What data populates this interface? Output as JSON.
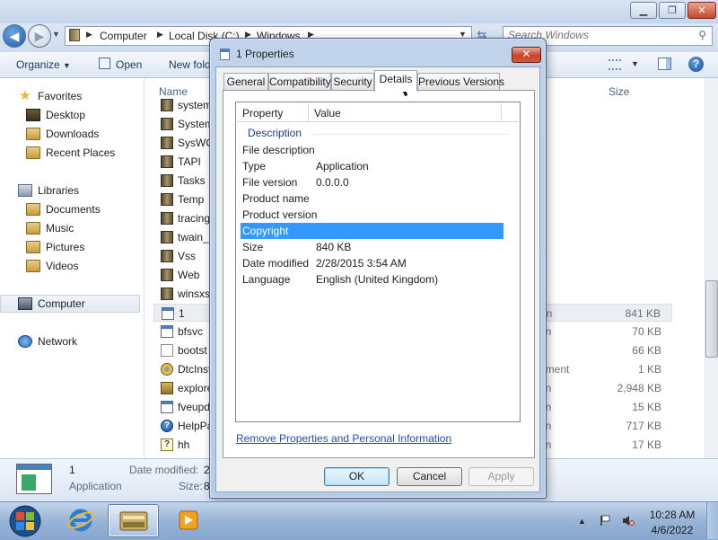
{
  "explorer": {
    "breadcrumb": [
      "Computer",
      "Local Disk (C:)",
      "Windows"
    ],
    "search_placeholder": "Search Windows",
    "toolbar": {
      "organize": "Organize",
      "open": "Open",
      "new_folder": "New fold"
    },
    "nav": {
      "favorites": "Favorites",
      "favorites_items": [
        "Desktop",
        "Downloads",
        "Recent Places"
      ],
      "libraries": "Libraries",
      "libraries_items": [
        "Documents",
        "Music",
        "Pictures",
        "Videos"
      ],
      "computer": "Computer",
      "network": "Network"
    },
    "columns": {
      "name": "Name",
      "size": "Size"
    },
    "files": [
      {
        "name": "system",
        "type": "",
        "size": "",
        "icon": "folder-icon"
      },
      {
        "name": "System",
        "type": "",
        "size": "",
        "icon": "folder-icon"
      },
      {
        "name": "SysWC",
        "type": "",
        "size": "",
        "icon": "folder-icon"
      },
      {
        "name": "TAPI",
        "type": "",
        "size": "",
        "icon": "folder-icon"
      },
      {
        "name": "Tasks",
        "type": "",
        "size": "",
        "icon": "folder-icon"
      },
      {
        "name": "Temp",
        "type": "",
        "size": "",
        "icon": "folder-icon"
      },
      {
        "name": "tracing",
        "type": "",
        "size": "",
        "icon": "folder-icon"
      },
      {
        "name": "twain_",
        "type": "",
        "size": "",
        "icon": "folder-icon"
      },
      {
        "name": "Vss",
        "type": "",
        "size": "",
        "icon": "folder-icon"
      },
      {
        "name": "Web",
        "type": "",
        "size": "",
        "icon": "folder-icon"
      },
      {
        "name": "winsxs",
        "type": "",
        "size": "",
        "icon": "folder-icon"
      },
      {
        "name": "1",
        "type": "on",
        "size": "841 KB",
        "icon": "application-icon"
      },
      {
        "name": "bfsvc",
        "type": "on",
        "size": "70 KB",
        "icon": "application-icon"
      },
      {
        "name": "bootst",
        "type": "",
        "size": "66 KB",
        "icon": "document-icon"
      },
      {
        "name": "DtcInst",
        "type": "ument",
        "size": "1 KB",
        "icon": "gear-icon"
      },
      {
        "name": "explore",
        "type": "on",
        "size": "2,948 KB",
        "icon": "explorer-icon"
      },
      {
        "name": "fveupd",
        "type": "on",
        "size": "15 KB",
        "icon": "application-icon"
      },
      {
        "name": "HelpPa",
        "type": "on",
        "size": "717 KB",
        "icon": "help-icon"
      },
      {
        "name": "hh",
        "type": "on",
        "size": "17 KB",
        "icon": "hh-icon"
      }
    ],
    "details_pane": {
      "name": "1",
      "type": "Application",
      "date_label": "Date modified:",
      "date_value": "2",
      "size_label": "Size:",
      "size_value": "8"
    }
  },
  "dialog": {
    "title": "1 Properties",
    "tabs": [
      "General",
      "Compatibility",
      "Security",
      "Details",
      "Previous Versions"
    ],
    "active_tab": "Details",
    "table_headers": {
      "property": "Property",
      "value": "Value"
    },
    "group": "Description",
    "properties": [
      {
        "key": "File description",
        "value": ""
      },
      {
        "key": "Type",
        "value": "Application"
      },
      {
        "key": "File version",
        "value": "0.0.0.0"
      },
      {
        "key": "Product name",
        "value": ""
      },
      {
        "key": "Product version",
        "value": ""
      },
      {
        "key": "Copyright",
        "value": ""
      },
      {
        "key": "Size",
        "value": "840 KB"
      },
      {
        "key": "Date modified",
        "value": "2/28/2015 3:54 AM"
      },
      {
        "key": "Language",
        "value": "English (United Kingdom)"
      }
    ],
    "selected_property": "Copyright",
    "remove_link": "Remove Properties and Personal Information",
    "buttons": {
      "ok": "OK",
      "cancel": "Cancel",
      "apply": "Apply"
    }
  },
  "taskbar": {
    "apps": [
      "internet-explorer-icon",
      "windows-explorer-icon",
      "media-player-icon"
    ],
    "time": "10:28 AM",
    "date": "4/6/2022"
  },
  "colors": {
    "selection": "#3399ff",
    "link": "#1f4fb3",
    "group_header": "#1e3a8c",
    "taskbar": "#98b4d6"
  }
}
